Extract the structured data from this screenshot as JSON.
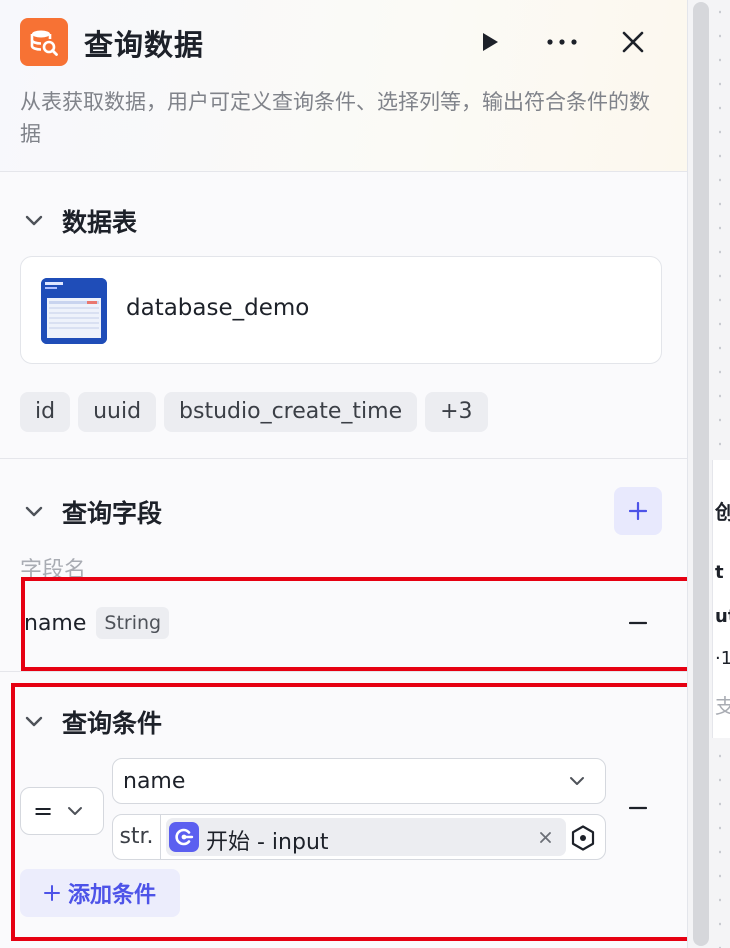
{
  "header": {
    "title": "查询数据",
    "description": "从表获取数据，用户可定义查询条件、选择列等，输出符合条件的数据",
    "run_icon": "play-icon",
    "more_icon": "more-icon",
    "close_icon": "close-icon"
  },
  "table_section": {
    "title": "数据表",
    "database_name": "database_demo",
    "tags": [
      "id",
      "uuid",
      "bstudio_create_time",
      "+3"
    ]
  },
  "fields_section": {
    "title": "查询字段",
    "column_header": "字段名",
    "fields": [
      {
        "name": "name",
        "type": "String"
      }
    ]
  },
  "conditions_section": {
    "title": "查询条件",
    "conditions": [
      {
        "operator": "=",
        "field": "name",
        "value_type": "str.",
        "value_ref": "开始 - input"
      }
    ],
    "add_label": "添加条件"
  },
  "background_fragments": [
    "创",
    "t",
    "ut",
    "·1",
    "支"
  ],
  "colors": {
    "accent": "#4d53e8",
    "app_icon": "#f77234",
    "highlight": "#e60012"
  }
}
